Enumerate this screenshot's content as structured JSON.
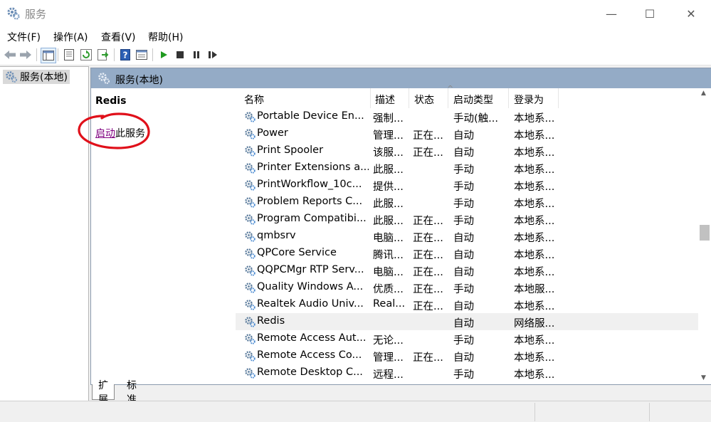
{
  "window": {
    "title": "服务",
    "minimize": "—",
    "maximize": "☐",
    "close": "✕"
  },
  "menu": [
    "文件(F)",
    "操作(A)",
    "查看(V)",
    "帮助(H)"
  ],
  "toolbar": {
    "icons": [
      "back-icon",
      "forward-icon",
      "show-tree-icon",
      "properties-icon",
      "refresh-icon",
      "export-icon",
      "help-icon",
      "view-icon",
      "start-icon",
      "stop-icon",
      "pause-icon",
      "restart-icon"
    ]
  },
  "tree": {
    "root_label": "服务(本地)"
  },
  "main": {
    "header_title": "服务(本地)"
  },
  "description": {
    "service_name": "Redis",
    "start_link": "启动",
    "start_suffix": "此服务"
  },
  "columns": [
    "名称",
    "描述",
    "状态",
    "启动类型",
    "登录为"
  ],
  "services": [
    {
      "name": "Portable Device En...",
      "desc": "强制...",
      "status": "",
      "startup": "手动(触...",
      "logon": "本地系..."
    },
    {
      "name": "Power",
      "desc": "管理...",
      "status": "正在...",
      "startup": "自动",
      "logon": "本地系..."
    },
    {
      "name": "Print Spooler",
      "desc": "该服...",
      "status": "正在...",
      "startup": "自动",
      "logon": "本地系..."
    },
    {
      "name": "Printer Extensions a...",
      "desc": "此服...",
      "status": "",
      "startup": "手动",
      "logon": "本地系..."
    },
    {
      "name": "PrintWorkflow_10c...",
      "desc": "提供...",
      "status": "",
      "startup": "手动",
      "logon": "本地系..."
    },
    {
      "name": "Problem Reports C...",
      "desc": "此服...",
      "status": "",
      "startup": "手动",
      "logon": "本地系..."
    },
    {
      "name": "Program Compatibi...",
      "desc": "此服...",
      "status": "正在...",
      "startup": "手动",
      "logon": "本地系..."
    },
    {
      "name": "qmbsrv",
      "desc": "电脑...",
      "status": "正在...",
      "startup": "自动",
      "logon": "本地系..."
    },
    {
      "name": "QPCore Service",
      "desc": "腾讯...",
      "status": "正在...",
      "startup": "自动",
      "logon": "本地系..."
    },
    {
      "name": "QQPCMgr RTP Serv...",
      "desc": "电脑...",
      "status": "正在...",
      "startup": "自动",
      "logon": "本地系..."
    },
    {
      "name": "Quality Windows A...",
      "desc": "优质...",
      "status": "正在...",
      "startup": "手动",
      "logon": "本地服..."
    },
    {
      "name": "Realtek Audio Univ...",
      "desc": "Real...",
      "status": "正在...",
      "startup": "自动",
      "logon": "本地系..."
    },
    {
      "name": "Redis",
      "desc": "",
      "status": "",
      "startup": "自动",
      "logon": "网络服..."
    },
    {
      "name": "Remote Access Aut...",
      "desc": "无论...",
      "status": "",
      "startup": "手动",
      "logon": "本地系..."
    },
    {
      "name": "Remote Access Co...",
      "desc": "管理...",
      "status": "正在...",
      "startup": "自动",
      "logon": "本地系..."
    },
    {
      "name": "Remote Desktop C...",
      "desc": "远程...",
      "status": "",
      "startup": "手动",
      "logon": "本地系..."
    }
  ],
  "selected_service": "Redis",
  "tabs": [
    "扩展",
    "标准"
  ],
  "colors": {
    "header_bg": "#94abc6",
    "link": "#800080",
    "annotation": "#e0101a"
  }
}
